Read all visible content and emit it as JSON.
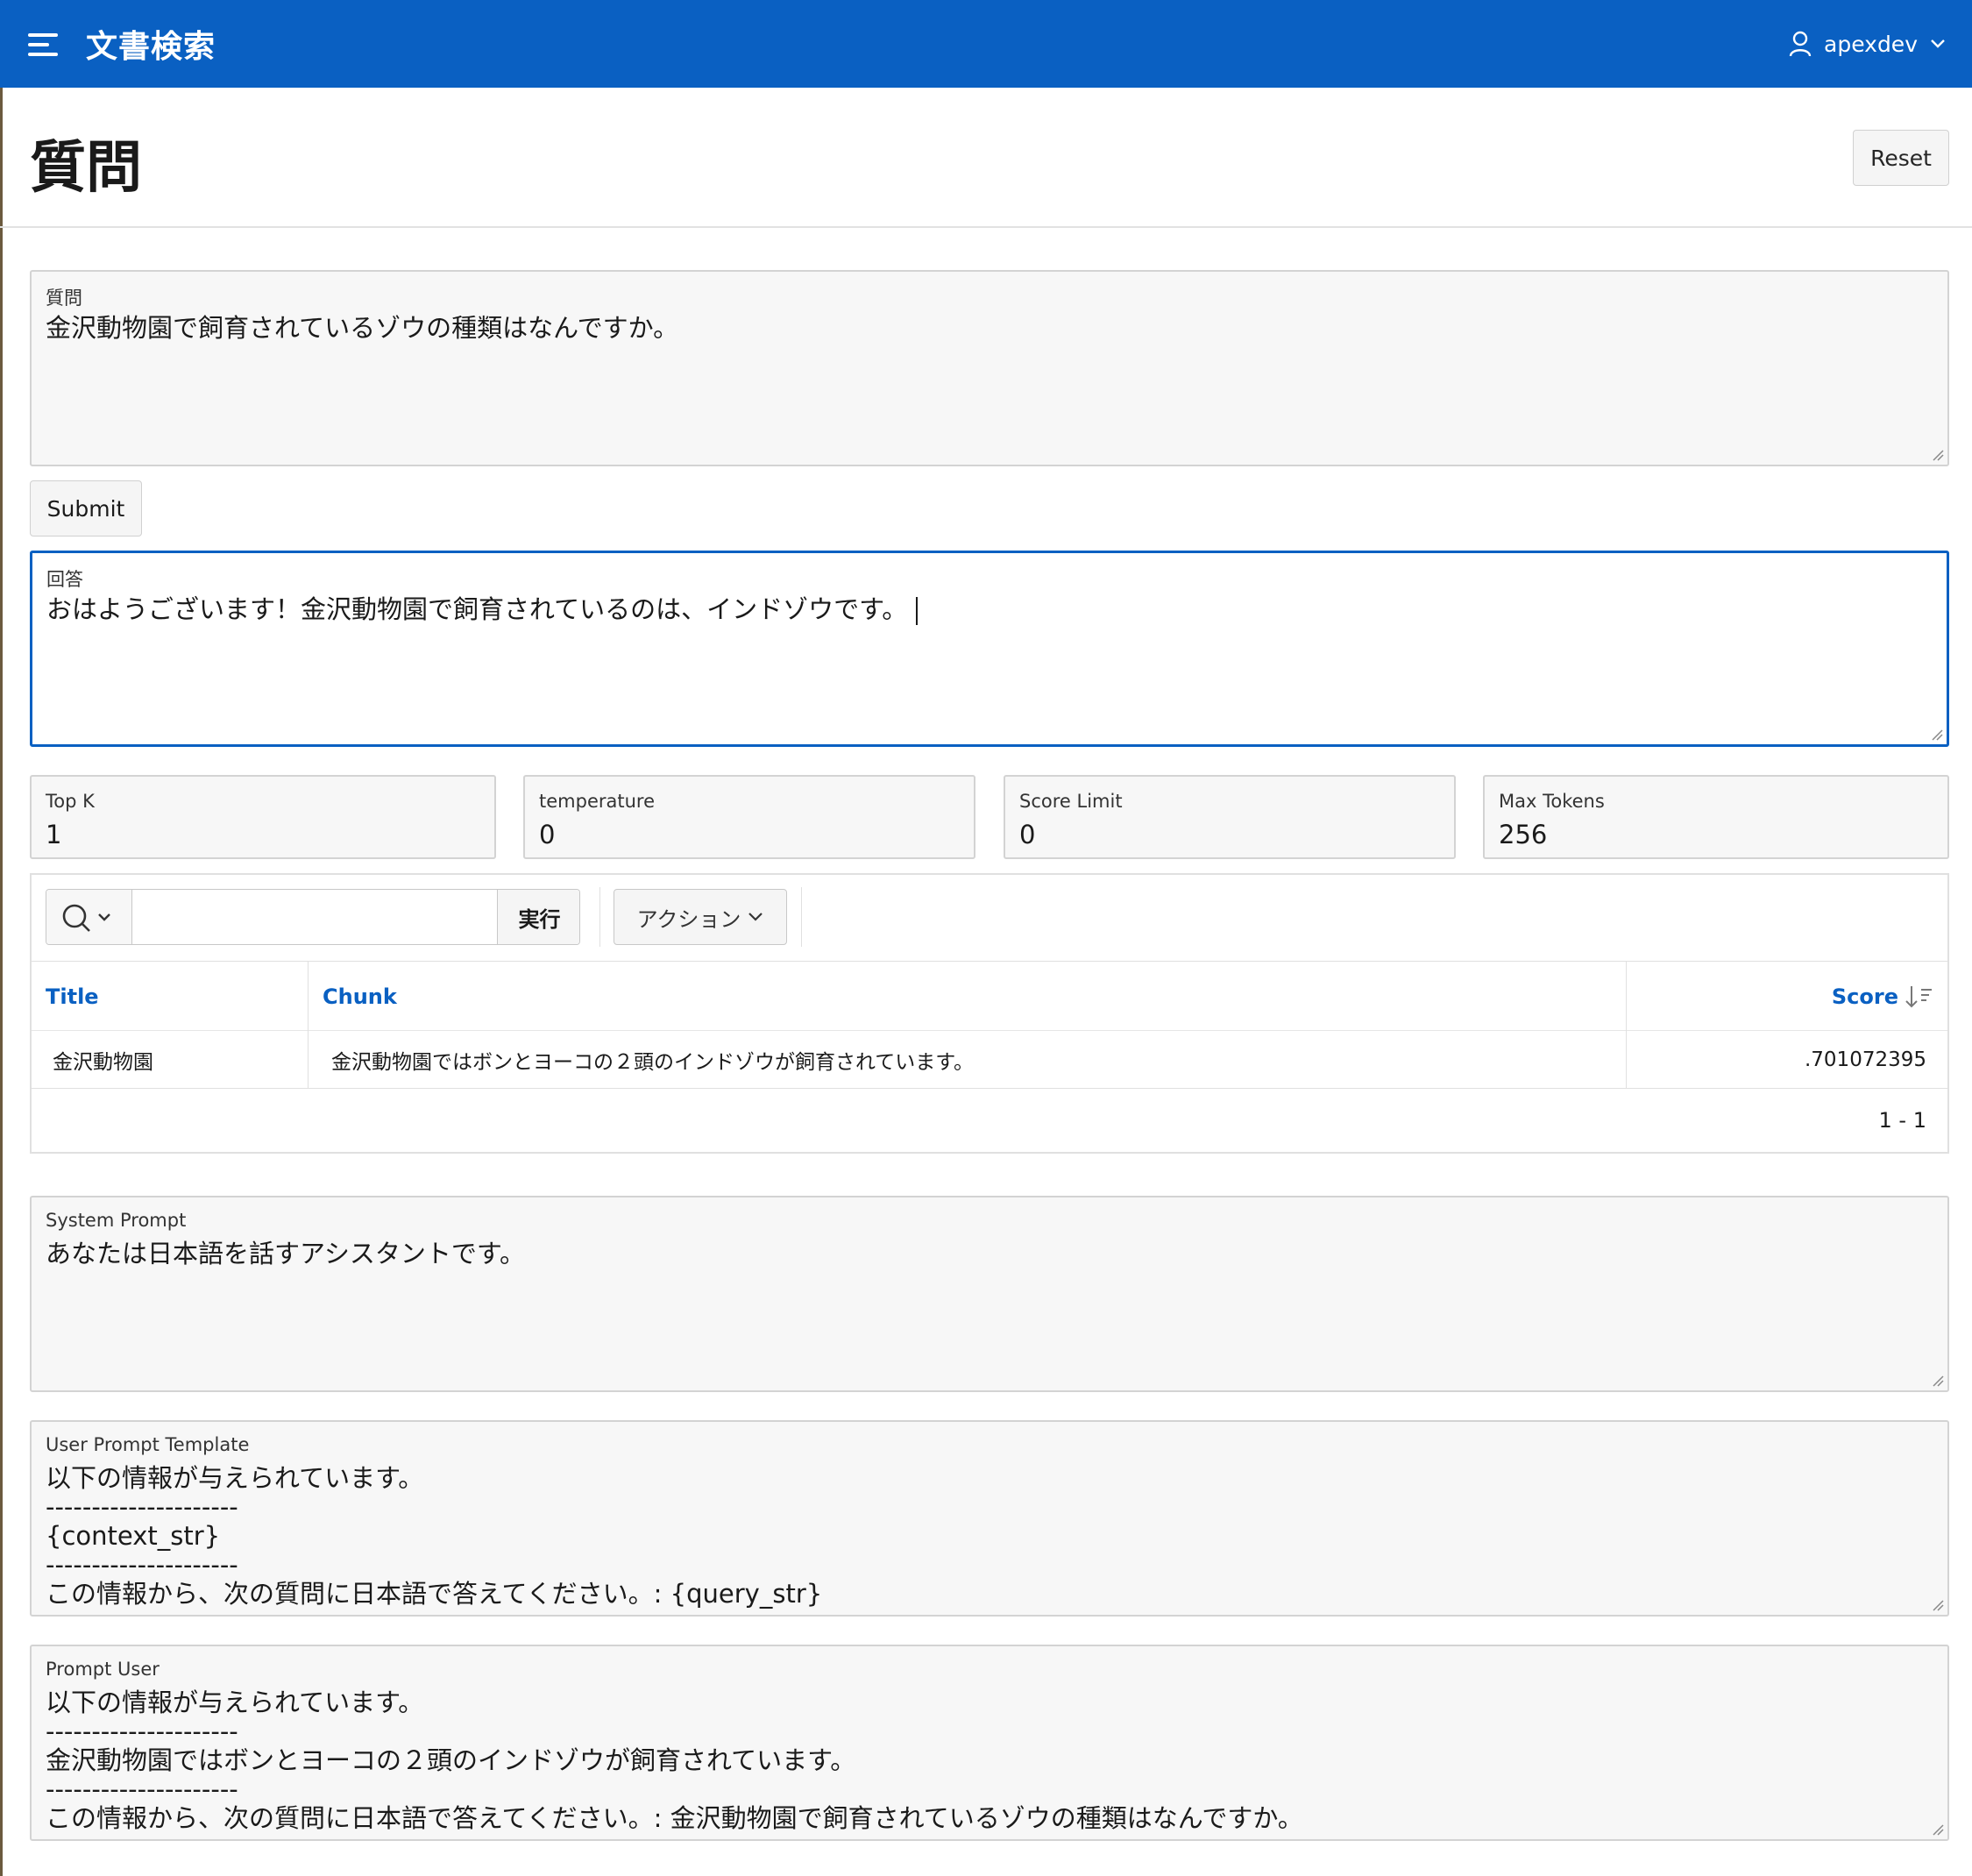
{
  "header": {
    "app_title": "文書検索",
    "user_name": "apexdev"
  },
  "page": {
    "title": "質問",
    "reset_label": "Reset"
  },
  "question": {
    "label": "質問",
    "value": "金沢動物園で飼育されているゾウの種類はなんですか。"
  },
  "submit_label": "Submit",
  "answer": {
    "label": "回答",
    "value": "おはようございます！金沢動物園で飼育されているのは、インドゾウです。"
  },
  "params": {
    "top_k": {
      "label": "Top K",
      "value": "1"
    },
    "temperature": {
      "label": "temperature",
      "value": "0"
    },
    "score_limit": {
      "label": "Score Limit",
      "value": "0"
    },
    "max_tokens": {
      "label": "Max Tokens",
      "value": "256"
    }
  },
  "report": {
    "search_placeholder": "",
    "go_label": "実行",
    "actions_label": "アクション",
    "columns": {
      "title": "Title",
      "chunk": "Chunk",
      "score": "Score"
    },
    "rows": [
      {
        "title": "金沢動物園",
        "chunk": "金沢動物園ではボンとヨーコの２頭のインドゾウが飼育されています。",
        "score": ".701072395"
      }
    ],
    "pagination": "1 - 1"
  },
  "system_prompt": {
    "label": "System Prompt",
    "value": "あなたは日本語を話すアシスタントです。"
  },
  "user_prompt_template": {
    "label": "User Prompt Template",
    "value": "以下の情報が与えられています。\n---------------------\n{context_str}\n---------------------\nこの情報から、次の質問に日本語で答えてください。: {query_str}"
  },
  "prompt_user": {
    "label": "Prompt User",
    "value": "以下の情報が与えられています。\n---------------------\n金沢動物園ではボンとヨーコの２頭のインドゾウが飼育されています。\n---------------------\nこの情報から、次の質問に日本語で答えてください。: 金沢動物園で飼育されているゾウの種類はなんですか。"
  },
  "colors": {
    "header_bg": "#0a60c2",
    "link_blue": "#0a60c2",
    "focus_border": "#0a60c2"
  }
}
